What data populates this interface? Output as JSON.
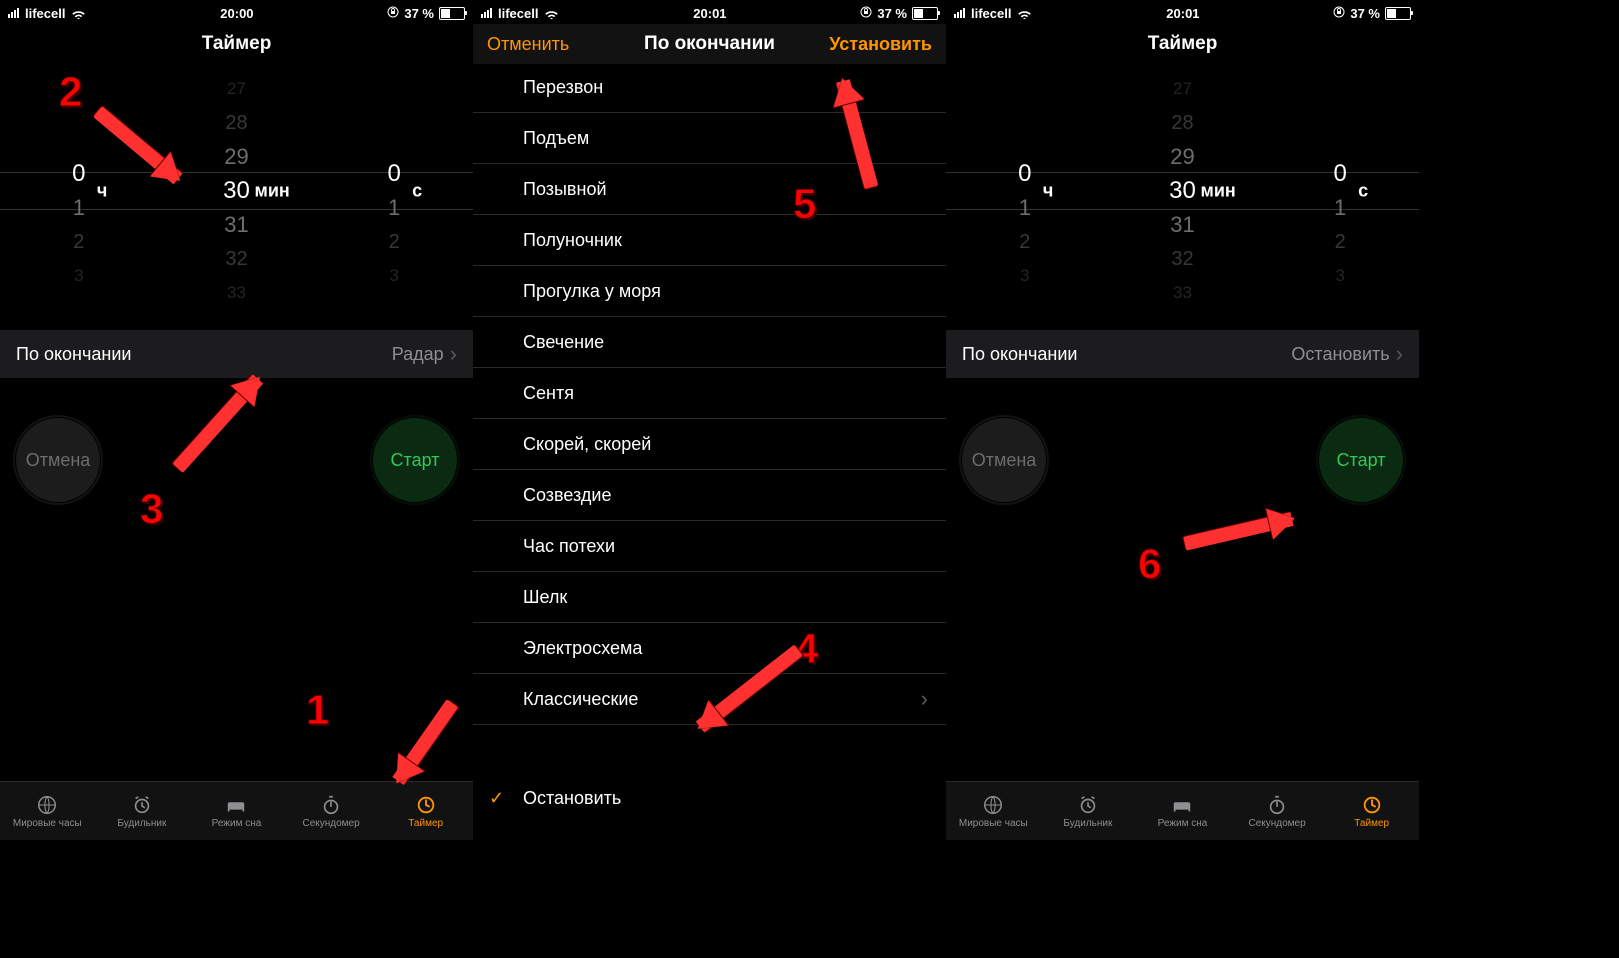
{
  "status": {
    "carrier": "lifecell",
    "battery": "37 %"
  },
  "screen1": {
    "time": "20:00",
    "title": "Таймер",
    "picker": {
      "hours": {
        "values": [
          "",
          "",
          "0",
          "1",
          "2",
          "3"
        ],
        "selected": "0",
        "unit": "ч"
      },
      "minutes": {
        "values": [
          "27",
          "28",
          "29",
          "30",
          "31",
          "32",
          "33"
        ],
        "selected": "30",
        "unit": "мин"
      },
      "seconds": {
        "values": [
          "",
          "",
          "0",
          "1",
          "2",
          "3"
        ],
        "selected": "0",
        "unit": "с"
      }
    },
    "row": {
      "label": "По окончании",
      "value": "Радар"
    },
    "cancel": "Отмена",
    "start": "Старт"
  },
  "screen2": {
    "time": "20:01",
    "nav": {
      "left": "Отменить",
      "title": "По окончании",
      "right": "Установить"
    },
    "items": [
      "Перезвон",
      "Подъем",
      "Позывной",
      "Полуночник",
      "Прогулка у моря",
      "Свечение",
      "Сентя",
      "Скорей, скорей",
      "Созвездие",
      "Час потехи",
      "Шелк",
      "Электросхема"
    ],
    "classic": "Классические",
    "stop": "Остановить"
  },
  "screen3": {
    "time": "20:01",
    "title": "Таймер",
    "row": {
      "label": "По окончании",
      "value": "Остановить"
    },
    "cancel": "Отмена",
    "start": "Старт"
  },
  "tabs": [
    {
      "label": "Мировые часы"
    },
    {
      "label": "Будильник"
    },
    {
      "label": "Режим сна"
    },
    {
      "label": "Секундомер"
    },
    {
      "label": "Таймер"
    }
  ],
  "ann": {
    "n1": "1",
    "n2": "2",
    "n3": "3",
    "n4": "4",
    "n5": "5",
    "n6": "6"
  }
}
